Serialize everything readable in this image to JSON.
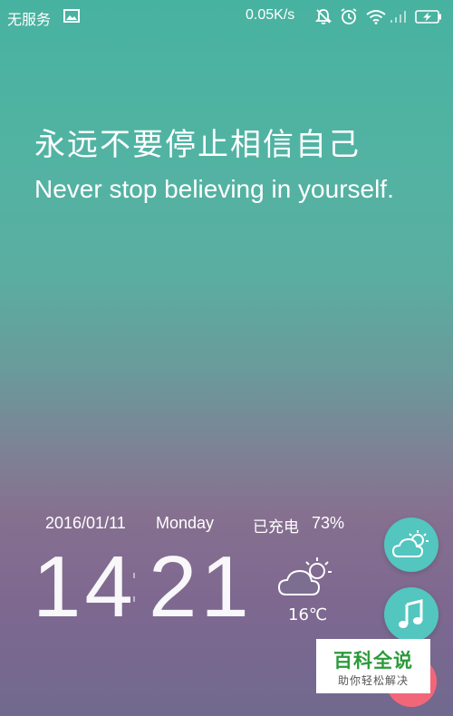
{
  "status_bar": {
    "carrier": "无服务",
    "net_speed": "0.05K/s",
    "icons": [
      "gallery-icon",
      "bell-off-icon",
      "alarm-icon",
      "wifi-icon",
      "signal-icon",
      "battery-charging-icon"
    ]
  },
  "quote": {
    "chinese": "永远不要停止相信自己",
    "english": "Never stop believing in yourself."
  },
  "info": {
    "date": "2016/01/11",
    "weekday": "Monday",
    "charging": "已充电",
    "battery": "73%"
  },
  "clock": {
    "hours": "14",
    "minutes": "21"
  },
  "weather": {
    "temperature": "16℃",
    "icon": "partly-cloudy-icon"
  },
  "fabs": [
    "weather-icon",
    "music-note-icon"
  ],
  "watermark": {
    "title": "百科全说",
    "subtitle": "助你轻松解决"
  },
  "colors": {
    "fab": "#52c6bf",
    "partial_fab": "#f2667a",
    "watermark_green": "#2a9b3a"
  }
}
